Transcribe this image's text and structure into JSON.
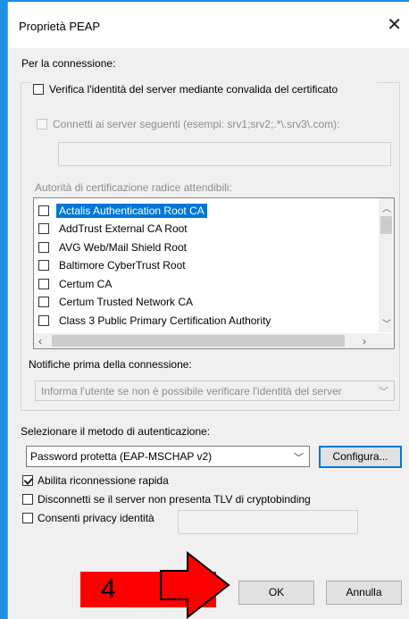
{
  "window": {
    "title": "Proprietà PEAP",
    "close_glyph": "✕"
  },
  "connection_header": "Per la connessione:",
  "verify_server": {
    "label": "Verifica l'identità del server mediante convalida del certificato",
    "checked": false
  },
  "connect_servers": {
    "label": "Connetti ai server seguenti (esempi: srv1;srv2;.*\\.srv3\\.com):",
    "checked": false,
    "enabled": false,
    "value": ""
  },
  "trusted_ca": {
    "label": "Autorità di certificazione radice attendibili:",
    "items": [
      {
        "label": "Actalis Authentication Root CA",
        "checked": false,
        "selected": true
      },
      {
        "label": "AddTrust External CA Root",
        "checked": false,
        "selected": false
      },
      {
        "label": "AVG Web/Mail Shield Root",
        "checked": false,
        "selected": false
      },
      {
        "label": "Baltimore CyberTrust Root",
        "checked": false,
        "selected": false
      },
      {
        "label": "Certum CA",
        "checked": false,
        "selected": false
      },
      {
        "label": "Certum Trusted Network CA",
        "checked": false,
        "selected": false
      },
      {
        "label": "Class 3 Public Primary Certification Authority",
        "checked": false,
        "selected": false
      }
    ]
  },
  "notifications": {
    "label": "Notifiche prima della connessione:",
    "selected": "Informa l'utente se non è possibile verificare l'identità del server"
  },
  "auth_method": {
    "label": "Selezionare il metodo di autenticazione:",
    "selected": "Password protetta (EAP-MSCHAP v2)",
    "configure_label": "Configura..."
  },
  "options": {
    "fast_reconnect": {
      "label": "Abilita riconnessione rapida",
      "checked": true
    },
    "disconnect_tlv": {
      "label": "Disconnetti se il server non presenta TLV di cryptobinding",
      "checked": false
    },
    "identity_privacy": {
      "label": "Consenti privacy identità",
      "checked": false,
      "value": ""
    }
  },
  "buttons": {
    "ok": "OK",
    "cancel": "Annulla"
  },
  "annotation": {
    "step_number": "4",
    "color": "#ff0000"
  },
  "colors": {
    "selection": "#0078d7",
    "desktop": "#1e8fe3"
  }
}
